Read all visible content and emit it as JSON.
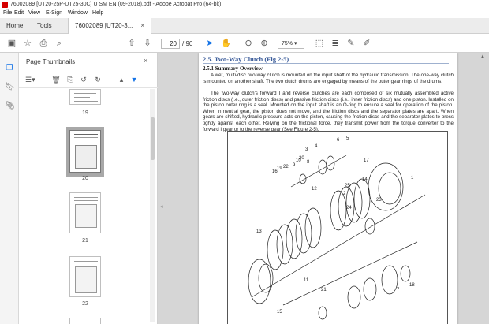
{
  "window": {
    "title": "76002089 [UT20-25P-UT25-30C] U SM EN (09-2018).pdf - Adobe Acrobat Pro (64-bit)"
  },
  "menu": [
    "File",
    "Edit",
    "View",
    "E-Sign",
    "Window",
    "Help"
  ],
  "tabs": {
    "home": "Home",
    "tools": "Tools",
    "document": "76002089 [UT20-3...",
    "close": "×"
  },
  "toolbar": {
    "page_current": "20",
    "page_total": "/ 90",
    "zoom": "75%"
  },
  "thumbnail_panel": {
    "title": "Page Thumbnails",
    "close": "×",
    "pages": [
      {
        "label": "19"
      },
      {
        "label": "20",
        "selected": true
      },
      {
        "label": "21"
      },
      {
        "label": "22"
      }
    ]
  },
  "document": {
    "section_title": "2.5. Two-Way Clutch (Fig 2-5)",
    "subsection_title": "2.5.1 Summary Overview",
    "paragraph1": "A wet, multi-disc two-way clutch is mounted on the input shaft of the hydraulic transmission. The one-way clutch is mounted on another shaft. The two clutch drums are engaged by means of the outer gear rings of the drums.",
    "paragraph2": "The two-way clutch's forward I and reverse clutches are each composed of six mutually assembled active friction discs (i.e., outer friction discs) and passive friction discs (i.e., inner friction discs) and one piston. Installed on the piston outer ring is a seal. Mounted on the input shaft is an O-ring to ensure a seal for operation of the piston. When in neutral gear, the piston does not move, and the friction discs and the separator plates are apart. When gears are shifted, hydraulic pressure acts on the piston, causing the friction discs and the separator plates to press tightly against each other. Relying on the frictional force, they transmit power from the torque converter to the forward I gear or to the reverse gear (See Figure 2-5).",
    "figure_labels": [
      "3",
      "4",
      "20",
      "8",
      "19",
      "9",
      "10",
      "22",
      "16",
      "6",
      "5",
      "17",
      "1",
      "14",
      "2",
      "12",
      "25",
      "23",
      "24",
      "13",
      "11",
      "21",
      "7",
      "18",
      "15"
    ]
  },
  "colors": {
    "accent": "#1473e6",
    "heading": "#3b5c9a",
    "acrobat_red": "#d40000"
  }
}
